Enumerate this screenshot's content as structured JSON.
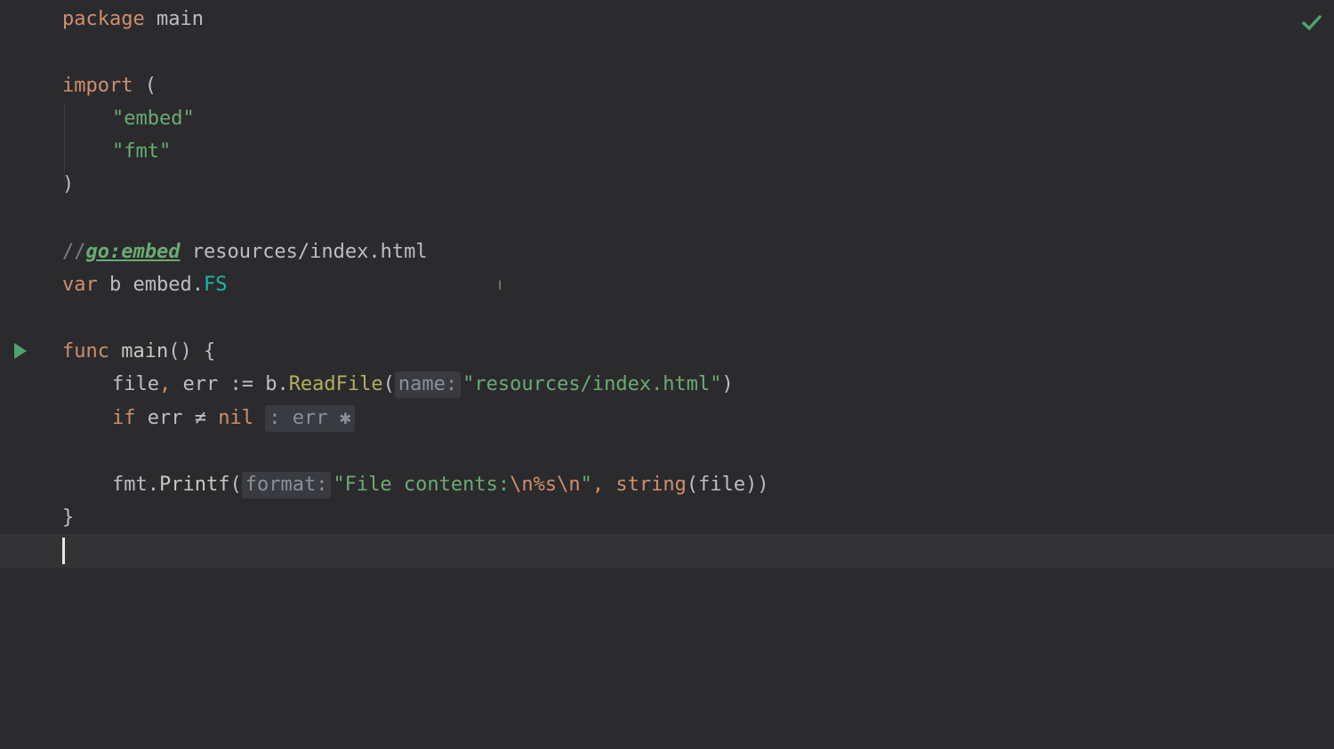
{
  "editor": {
    "language": "Go",
    "status_icon": "check-icon",
    "status_color": "#4ea36b",
    "run_icon": "run-triangle-icon"
  },
  "lines": {
    "l1": {
      "kw": "package",
      "name": "main"
    },
    "l3": {
      "kw": "import",
      "paren": "("
    },
    "l4": {
      "str": "\"embed\""
    },
    "l5": {
      "str": "\"fmt\""
    },
    "l6": {
      "paren": ")"
    },
    "l8": {
      "slashes": "//",
      "directive": "go:embed",
      "path": "resources/index.html"
    },
    "l9": {
      "kw": "var",
      "ident": "b",
      "pkg": "embed.",
      "type": "FS"
    },
    "l11": {
      "kw": "func",
      "name": "main",
      "rest": "() {"
    },
    "l12": {
      "vars": "file",
      "comma": ",",
      "err": " err := b.",
      "fn": "ReadFile",
      "open": "(",
      "hint": "name:",
      "str": "\"resources/index.html\"",
      "close": ")"
    },
    "l13": {
      "kw": "if",
      "expr": " err ≠ ",
      "nil": "nil",
      "hint": ": err ✱"
    },
    "l15": {
      "pkg": "fmt.",
      "fn": "Printf",
      "open": "(",
      "hint": "format:",
      "str_a": "\"File contents:",
      "esc": "\\n%s\\n",
      "str_b": "\"",
      "comma": ",",
      "builtin": "string",
      "args": "(file))"
    },
    "l16": {
      "brace": "}"
    }
  }
}
